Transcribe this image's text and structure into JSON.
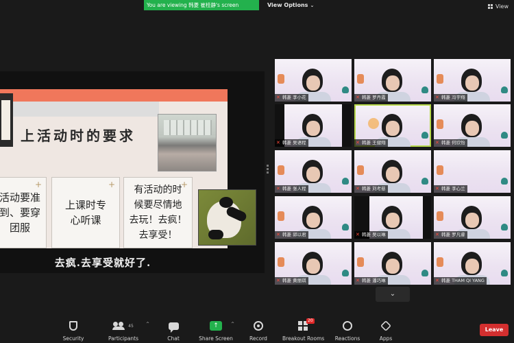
{
  "topbar": {
    "viewing_text": "You are viewing 韩菱 崔桂静's screen",
    "view_options_label": "View Options",
    "view_label": "View"
  },
  "slide": {
    "title": "上活动时的要求",
    "card1": [
      "活动要准",
      "到、要穿",
      "团服"
    ],
    "card2": [
      "上课时专",
      "心听课"
    ],
    "card3": [
      "有活动的时",
      "候要尽情地",
      "去玩！去疯！",
      "去享受！"
    ],
    "subtitle": "去疯.去享受就好了."
  },
  "participants": [
    {
      "name": "韩菱 李小花"
    },
    {
      "name": "韩菱 罗丹霞"
    },
    {
      "name": "韩菱 冯宇翔"
    },
    {
      "name": "韩菱 吴语程"
    },
    {
      "name": "韩菱 王健翔"
    },
    {
      "name": "韩菱 何欣怡"
    },
    {
      "name": "韩菱 张人程"
    },
    {
      "name": "韩菱 刘考慈"
    },
    {
      "name": "韩菱 李心兰"
    },
    {
      "name": "韩菱 郭以君"
    },
    {
      "name": "韩菱 吴以琳"
    },
    {
      "name": "韩菱 罗凡睿"
    },
    {
      "name": "韩菱 黄丽琪"
    },
    {
      "name": "韩菱 潘巧琳"
    },
    {
      "name": "韩菱 THAM QI YANG"
    }
  ],
  "toolbar": {
    "security": "Security",
    "participants": "Participants",
    "participants_count": "45",
    "chat": "Chat",
    "share_screen": "Share Screen",
    "record": "Record",
    "breakout_rooms": "Breakout Rooms",
    "breakout_badge": "20",
    "reactions": "Reactions",
    "apps": "Apps",
    "leave": "Leave"
  },
  "colors": {
    "share_green": "#23b14d",
    "leave_red": "#d32f2f",
    "active_speaker_border": "#b7d84a",
    "slide_accent": "#f0775b"
  }
}
